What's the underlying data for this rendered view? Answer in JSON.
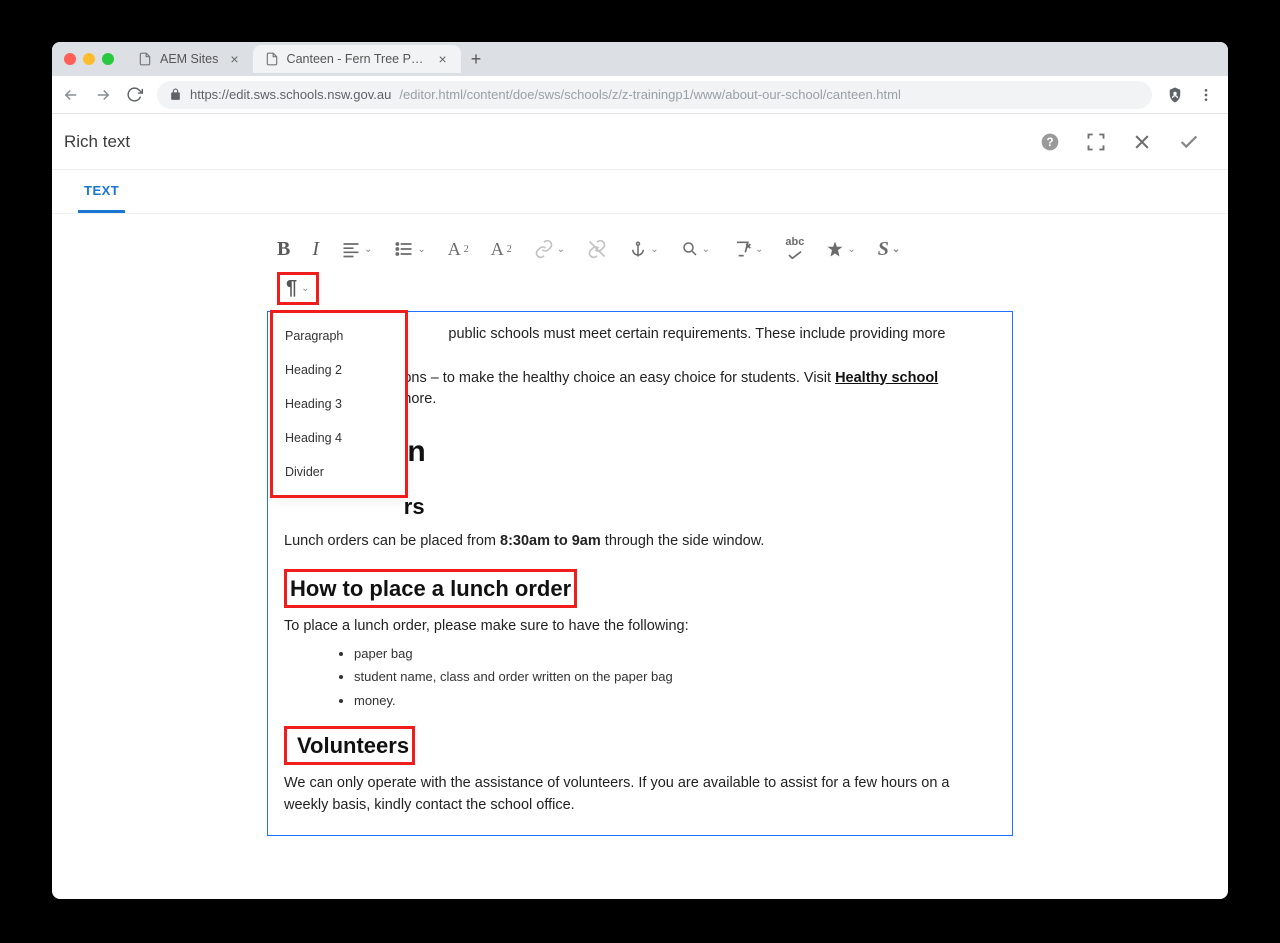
{
  "browser": {
    "tabs": [
      {
        "label": "AEM Sites",
        "active": false
      },
      {
        "label": "Canteen - Fern Tree Public Sch",
        "active": true
      }
    ],
    "url_host": "https://edit.sws.schools.nsw.gov.au",
    "url_path": "/editor.html/content/doe/sws/schools/z/z-trainingp1/www/about-our-school/canteen.html"
  },
  "editor": {
    "title": "Rich text",
    "subtab": "TEXT"
  },
  "paragraph_menu": {
    "items": [
      "Paragraph",
      "Heading 2",
      "Heading 3",
      "Heading 4",
      "Divider"
    ]
  },
  "content": {
    "intro_fragment_1": " public schools must meet certain requirements. These include providing more healthy ",
    "intro_fragment_2": "ons – to make the healthy choice an easy choice for students. Visit ",
    "link_text": "Healthy school ",
    "intro_fragment_3": "more.",
    "h2_partial": "on",
    "h3_partial": "rs",
    "orders_text_pre": "Lunch orders can be placed from ",
    "orders_time": "8:30am to 9am",
    "orders_text_post": " through the side window.",
    "h3_place_order": "How to place a lunch order",
    "place_order_intro": "To place a lunch order, please make sure to have the following:",
    "bullets": [
      "paper bag",
      "student name, class and order written on the paper bag",
      "money."
    ],
    "h3_volunteers": "Volunteers",
    "volunteers_text": "We can only operate with the assistance of volunteers. If you are available to assist for a few hours on a weekly basis, kindly contact the school office."
  }
}
